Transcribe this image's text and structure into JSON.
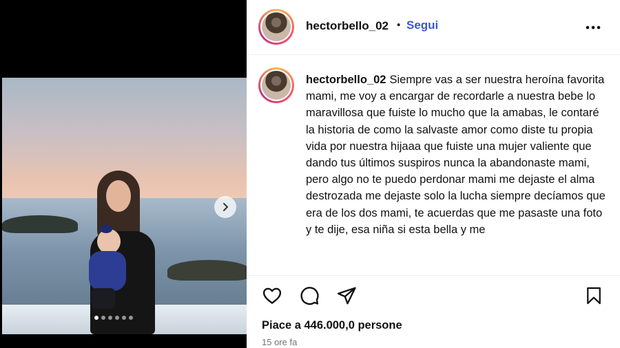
{
  "post": {
    "username": "hectorbello_02",
    "separator": "•",
    "follow_label": "Segui",
    "caption_text": "Siempre vas a ser nuestra heroína favorita mami, me voy a encargar de recordarle a nuestra bebe lo maravillosa que fuiste lo mucho que la amabas, le contaré la historia de como la salvaste amor como diste tu propia vida por nuestra hijaaa que fuiste una mujer valiente que dando tus últimos suspiros nunca la abandonaste mami, pero algo no te puedo perdonar mami me dejaste el alma destrozada me dejaste solo la lucha siempre decíamos que era de los dos mami, te acuerdas que me pasaste una foto y te dije, esa niña si esta bella y me",
    "likes_text": "Piace a 446.000,0 persone",
    "time_text": "15 ore fa"
  },
  "carousel": {
    "count": 6,
    "active_index": 0
  },
  "icons": {
    "more": "more-horizontal-icon",
    "like": "heart-icon",
    "comment": "comment-icon",
    "share": "send-icon",
    "save": "bookmark-icon",
    "next": "chevron-right-icon"
  },
  "colors": {
    "follow": "#3a58c9",
    "text": "#111111",
    "muted": "#737373"
  }
}
